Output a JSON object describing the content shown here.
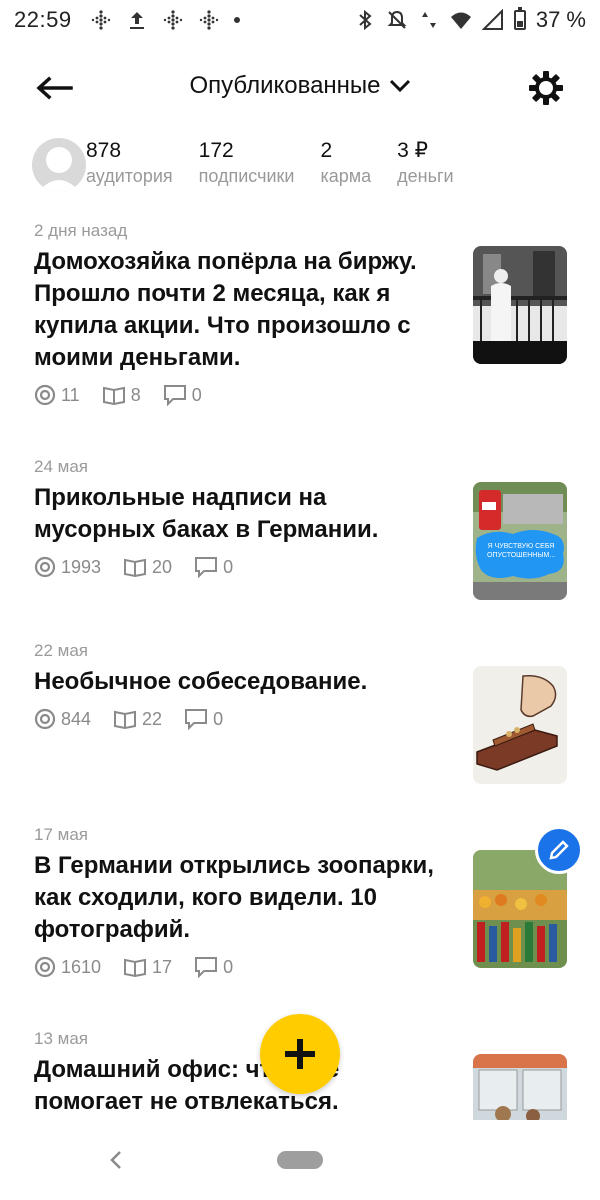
{
  "status_bar": {
    "time": "22:59",
    "battery": "37 %",
    "left_icons": [
      "dots-grid-icon",
      "upload-icon",
      "dots-grid-icon",
      "dots-grid-icon",
      "dot-icon"
    ],
    "right_icons": [
      "bluetooth-icon",
      "bell-off-icon",
      "data-arrows-icon",
      "wifi-icon",
      "signal-icon",
      "battery-icon"
    ]
  },
  "header": {
    "title": "Опубликованные",
    "back_icon": "arrow-left-icon",
    "settings_icon": "gear-icon",
    "dropdown_icon": "chevron-down-icon"
  },
  "stats": [
    {
      "value": "878",
      "label": "аудитория"
    },
    {
      "value": "172",
      "label": "подписчики"
    },
    {
      "value": "2",
      "label": "карма"
    },
    {
      "value": "3 ₽",
      "label": "деньги"
    }
  ],
  "articles": [
    {
      "date": "2 дня назад",
      "title": "Домохозяйка попёрла на биржу. Прошло почти 2 месяца, как я купила акции. Что произошло с моими деньгами.",
      "views": "11",
      "reads": "8",
      "comments": "0"
    },
    {
      "date": "24 мая",
      "title": "Прикольные надписи на мусорных баках в Германии.",
      "views": "1993",
      "reads": "20",
      "comments": "0",
      "thumb_text": "Я ЧУВСТВУЮ СЕБЯ ОПУСТОШЕННЫМ..."
    },
    {
      "date": "22 мая",
      "title": "Необычное собеседование.",
      "views": "844",
      "reads": "22",
      "comments": "0"
    },
    {
      "date": "17 мая",
      "title": "В Германии открылись зоопарки, как сходили, кого видели. 10 фотографий.",
      "views": "1610",
      "reads": "17",
      "comments": "0"
    },
    {
      "date": "13 мая",
      "title": "Домашний офис: что ещё помогает не отвлекаться."
    }
  ],
  "colors": {
    "accent_fab": "#ffcc00",
    "edit_fab": "#1a73e8",
    "muted_text": "#9a9a9a"
  }
}
